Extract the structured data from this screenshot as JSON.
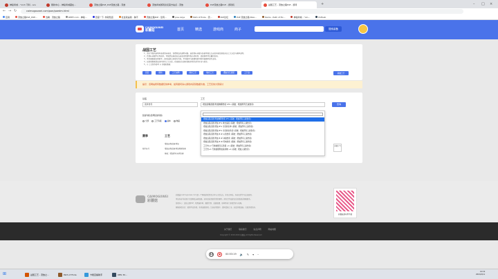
{
  "browser": {
    "tabs": [
      {
        "label": "神秘商城 - \"xinh 不料 - acu",
        "color": "#c0392b"
      },
      {
        "label": "刷新中心 - 神秘商城藏在…",
        "color": "#c0392b"
      },
      {
        "label": "流放之路PoE_PoE流放之路 - 流放",
        "color": "#e74c3c"
      },
      {
        "label": "流放商城游戏论坛官方站点 - 流放",
        "color": "#e74c3c"
      },
      {
        "label": "PoE流放之路PoE - 游戏机",
        "color": "#e74c3c"
      },
      {
        "label": "战国工艺 - 流放之路PoE - 游戏",
        "color": "#e74c3c"
      }
    ],
    "url": "caimogouwei.com/poe/poedm.html",
    "bookmarks": [
      "应用",
      "流放之路PoE_POE…",
      "当看 · 流放之路",
      "DEET.com - 神秘…",
      "百度一下, 你就知道",
      "社会就是我 - 跨不",
      "流放之路PoE - 您有…",
      "poe.ninja",
      "Path of Exile - 流…",
      "PoE论坛",
      "PoE 流放之路 NGA…",
      "Items - Path of Ex…",
      "神秘商城 - \"xin…",
      "PoELab"
    ]
  },
  "header": {
    "logo_top": "CAIMOGUWEI",
    "logo_bottom": "彩蘑菇",
    "nav": [
      "首页",
      "精选",
      "游戏商",
      "商子"
    ],
    "search_btn": "搜索装备"
  },
  "card": {
    "title": "战国工艺",
    "lines": [
      "1、请在下面的选项中选择目标基底、查看物品的通用词缀。选择目标词缀与装备等级后点击查询按钮获取对应工艺方案与概率说明。",
      "2、若目标词缀不在列表中，可能是该基底无法出现或需要特殊方式获得，请更换条件后重新查询。",
      "3、本页面数据仅供参考，实际结果以游戏内为准，不同版本与联盟机制可能导致概率发生变化。",
      "4、如发现数据错误或有新的工艺方案，欢迎通过反馈按钮联系我们进行补充与修正。",
      "5、◎ 工艺制作参考  ◎ 详细的数据"
    ],
    "buttons": [
      "首页",
      "刷新",
      "工艺说明",
      "简易工艺",
      "联合工艺",
      "镶嵌宝石搭配",
      "工艺表"
    ],
    "right_button": "基础工艺"
  },
  "notice": "提示：该网站所有数据仅供参考，如有疑问请以游戏内实际数据为准，工艺仅供大家探讨",
  "panel": {
    "base_label": "基底",
    "base_value": "双手长弓",
    "craft_label": "工艺",
    "craft_value": "增加远程武器 附加物理伤害 #% (基础：增加所有元素伤害)",
    "query_btn": "查询",
    "radio_label": "装备等级(选择装备等级)",
    "radios": [
      "全部",
      "工艺等级",
      "副本",
      "物品"
    ],
    "dropdown_options": [
      "增加远程武器 附加物理伤害 #% (基础：增加所有元素伤害)",
      "增加远程武器 增加 #% 攻击速度 (基础：增加所有元素伤害)",
      "增加远程武器 增加 #% 全局暴击率 (基础：增加所有元素伤害)",
      "增加远程武器 增加 #% 全局暴击伤害 (基础：增加所有元素伤害)",
      "增加远程武器 附加 #-# 火焰伤害 (基础：增加所有元素伤害)",
      "增加远程武器 附加 #-# 冰霜伤害 (基础：增加所有元素伤害)",
      "增加远程武器 附加 #-# 闪电伤害 (基础：增加所有元素伤害)",
      "工艺台+2 弓类技能宝石等级 +1 (基础：增加所有元素伤害)",
      "工艺台+1 弓类技能附加投射物 +1 (基础：增加元素伤害)"
    ],
    "table_headers": [
      "赛季",
      "工艺"
    ],
    "row": {
      "season": "双手长弓",
      "c1": "增加远程武器 附加",
      "c2": "增加远程武器 附加物理伤害",
      "c3": "基础：增加所有元素伤害"
    },
    "side_label": "前缀 (7)"
  },
  "footer": {
    "logo_top": "CAIMOGUWEI",
    "logo_bottom": "彩蘑菇",
    "lines": [
      "彩蘑菇(caimogouwei.com)是一个网络游戏资讯分享与讨论站点，非官方网站，内容仅供学习交流使用。",
      "本站内容均来源于互联网及玩家投稿，如有侵权请联系我们删除。商务合作及建议反馈请通过邮箱联系。",
      "游戏中心：流放之路PoE、暗黑破坏神、魔兽世界、英雄联盟、原神等热门游戏资讯与攻略。",
      "健康游戏忠告：抵制不良游戏，拒绝盗版游戏。注意自我保护，谨防受骗上当。适度游戏益脑，沉迷游戏伤身。"
    ],
    "qr_caption": "彩蘑菇发布到下载"
  },
  "bottombar": {
    "links": [
      "关于我们",
      "联系我们",
      "免责声明",
      "网站地图"
    ],
    "copyright": "Copyright © 2019-2024 彩蘑菇 All Rights Reserved"
  },
  "player": {
    "time": "00:53:19"
  },
  "taskbar": {
    "items": [
      {
        "label": "战国工艺 - 流放之…",
        "color": "#d35400"
      },
      {
        "label": "Path of Exile",
        "color": "#8e5a2b"
      },
      {
        "label": "卡能直播助手",
        "color": "#3498db"
      },
      {
        "label": "OBS 30…",
        "color": "#34495e"
      }
    ],
    "time": "14:19",
    "date": "2024/1/11"
  }
}
